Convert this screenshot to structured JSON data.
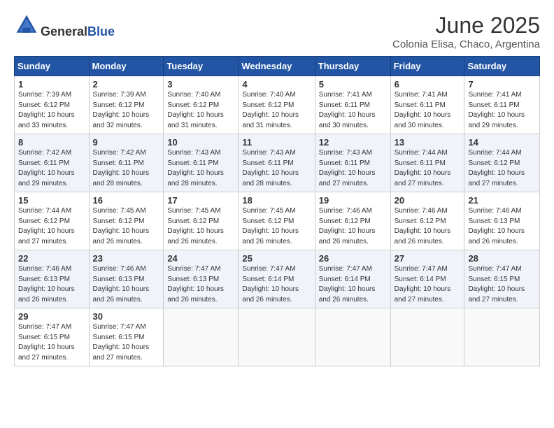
{
  "header": {
    "logo_general": "General",
    "logo_blue": "Blue",
    "title": "June 2025",
    "location": "Colonia Elisa, Chaco, Argentina"
  },
  "weekdays": [
    "Sunday",
    "Monday",
    "Tuesday",
    "Wednesday",
    "Thursday",
    "Friday",
    "Saturday"
  ],
  "weeks": [
    [
      {
        "day": 1,
        "sunrise": "7:39 AM",
        "sunset": "6:12 PM",
        "daylight": "10 hours and 33 minutes."
      },
      {
        "day": 2,
        "sunrise": "7:39 AM",
        "sunset": "6:12 PM",
        "daylight": "10 hours and 32 minutes."
      },
      {
        "day": 3,
        "sunrise": "7:40 AM",
        "sunset": "6:12 PM",
        "daylight": "10 hours and 31 minutes."
      },
      {
        "day": 4,
        "sunrise": "7:40 AM",
        "sunset": "6:12 PM",
        "daylight": "10 hours and 31 minutes."
      },
      {
        "day": 5,
        "sunrise": "7:41 AM",
        "sunset": "6:11 PM",
        "daylight": "10 hours and 30 minutes."
      },
      {
        "day": 6,
        "sunrise": "7:41 AM",
        "sunset": "6:11 PM",
        "daylight": "10 hours and 30 minutes."
      },
      {
        "day": 7,
        "sunrise": "7:41 AM",
        "sunset": "6:11 PM",
        "daylight": "10 hours and 29 minutes."
      }
    ],
    [
      {
        "day": 8,
        "sunrise": "7:42 AM",
        "sunset": "6:11 PM",
        "daylight": "10 hours and 29 minutes."
      },
      {
        "day": 9,
        "sunrise": "7:42 AM",
        "sunset": "6:11 PM",
        "daylight": "10 hours and 28 minutes."
      },
      {
        "day": 10,
        "sunrise": "7:43 AM",
        "sunset": "6:11 PM",
        "daylight": "10 hours and 28 minutes."
      },
      {
        "day": 11,
        "sunrise": "7:43 AM",
        "sunset": "6:11 PM",
        "daylight": "10 hours and 28 minutes."
      },
      {
        "day": 12,
        "sunrise": "7:43 AM",
        "sunset": "6:11 PM",
        "daylight": "10 hours and 27 minutes."
      },
      {
        "day": 13,
        "sunrise": "7:44 AM",
        "sunset": "6:11 PM",
        "daylight": "10 hours and 27 minutes."
      },
      {
        "day": 14,
        "sunrise": "7:44 AM",
        "sunset": "6:12 PM",
        "daylight": "10 hours and 27 minutes."
      }
    ],
    [
      {
        "day": 15,
        "sunrise": "7:44 AM",
        "sunset": "6:12 PM",
        "daylight": "10 hours and 27 minutes."
      },
      {
        "day": 16,
        "sunrise": "7:45 AM",
        "sunset": "6:12 PM",
        "daylight": "10 hours and 26 minutes."
      },
      {
        "day": 17,
        "sunrise": "7:45 AM",
        "sunset": "6:12 PM",
        "daylight": "10 hours and 26 minutes."
      },
      {
        "day": 18,
        "sunrise": "7:45 AM",
        "sunset": "6:12 PM",
        "daylight": "10 hours and 26 minutes."
      },
      {
        "day": 19,
        "sunrise": "7:46 AM",
        "sunset": "6:12 PM",
        "daylight": "10 hours and 26 minutes."
      },
      {
        "day": 20,
        "sunrise": "7:46 AM",
        "sunset": "6:12 PM",
        "daylight": "10 hours and 26 minutes."
      },
      {
        "day": 21,
        "sunrise": "7:46 AM",
        "sunset": "6:13 PM",
        "daylight": "10 hours and 26 minutes."
      }
    ],
    [
      {
        "day": 22,
        "sunrise": "7:46 AM",
        "sunset": "6:13 PM",
        "daylight": "10 hours and 26 minutes."
      },
      {
        "day": 23,
        "sunrise": "7:46 AM",
        "sunset": "6:13 PM",
        "daylight": "10 hours and 26 minutes."
      },
      {
        "day": 24,
        "sunrise": "7:47 AM",
        "sunset": "6:13 PM",
        "daylight": "10 hours and 26 minutes."
      },
      {
        "day": 25,
        "sunrise": "7:47 AM",
        "sunset": "6:14 PM",
        "daylight": "10 hours and 26 minutes."
      },
      {
        "day": 26,
        "sunrise": "7:47 AM",
        "sunset": "6:14 PM",
        "daylight": "10 hours and 26 minutes."
      },
      {
        "day": 27,
        "sunrise": "7:47 AM",
        "sunset": "6:14 PM",
        "daylight": "10 hours and 27 minutes."
      },
      {
        "day": 28,
        "sunrise": "7:47 AM",
        "sunset": "6:15 PM",
        "daylight": "10 hours and 27 minutes."
      }
    ],
    [
      {
        "day": 29,
        "sunrise": "7:47 AM",
        "sunset": "6:15 PM",
        "daylight": "10 hours and 27 minutes."
      },
      {
        "day": 30,
        "sunrise": "7:47 AM",
        "sunset": "6:15 PM",
        "daylight": "10 hours and 27 minutes."
      },
      null,
      null,
      null,
      null,
      null
    ]
  ]
}
